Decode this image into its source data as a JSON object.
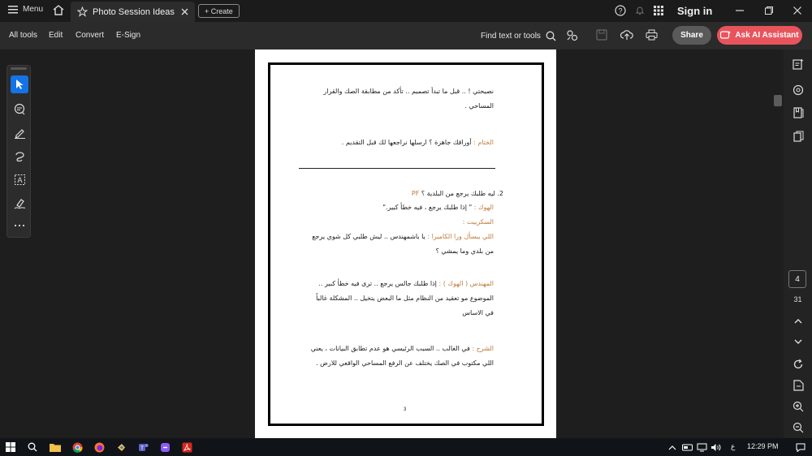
{
  "titlebar": {
    "menu_label": "Menu",
    "tab_title": "Photo Session Ideas",
    "create_label": "+ Create",
    "sign_in_label": "Sign in"
  },
  "toolbar": {
    "menu_items": [
      "All tools",
      "Edit",
      "Convert",
      "E-Sign"
    ],
    "find_label": "Find text or tools",
    "share_label": "Share",
    "ai_label": "Ask AI Assistant"
  },
  "document": {
    "lines": [
      {
        "text": "نصيحتي ! .. قبل ما تبدأ تصميم .. تأكد من مطابقة الصك والقرار"
      },
      {
        "text": "المساحي ."
      },
      {
        "label": "الختام :",
        "text": " أوراقك جاهزة ؟ ارسلها نراجعها لك قبل التقديم ."
      },
      {
        "text": "2.  ليه طلبك يرجع من البلدية ؟",
        "suffix": " PF"
      },
      {
        "label": "الهوك :",
        "text": " \" إذا طلبك يرجع ، فيه خطأ كبير.\""
      },
      {
        "label": "السكريبت :",
        "text": ""
      },
      {
        "label": "اللي يبسأل ورا الكاميرا :",
        "text": " يا باشمهندس .. ليش طلبي كل شوي يرجع"
      },
      {
        "text": "من بلدي وما يمشي ؟"
      },
      {
        "label": "المهندس ( الهوك ) :",
        "text": " إذا طلبك جالس يرجع .. ترى فيه خطأ كبير .."
      },
      {
        "text": "الموضوع مو تعقيد من النظام مثل ما البعض يتخيل .. المشكلة غالباً"
      },
      {
        "text": "في الاساس"
      },
      {
        "label": "الشرح :",
        "text": " في الغالب .. السبب الرئيسي هو عدم تطابق البيانات ، يعني"
      },
      {
        "text": "اللي مكتوب في الصك يختلف عن الرفع المساحي الواقعي للارض ."
      }
    ],
    "page_number": "3"
  },
  "navigation": {
    "current_page": "4",
    "total_pages": "31"
  },
  "taskbar": {
    "language": "ع",
    "time": "12:29 PM"
  },
  "colors": {
    "accent": "#1473e6",
    "ai_button": "#e8545c",
    "highlight_text": "#c07a3a"
  }
}
